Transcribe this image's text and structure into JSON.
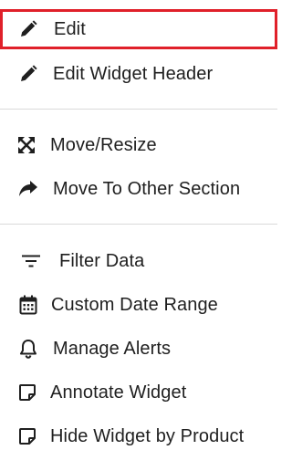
{
  "menu": {
    "items": [
      {
        "label": "Edit",
        "icon": "pencil-icon",
        "selected": true
      },
      {
        "label": "Edit Widget Header",
        "icon": "pencil-icon"
      },
      {
        "label": "Move/Resize",
        "icon": "expand-arrows-icon"
      },
      {
        "label": "Move To Other Section",
        "icon": "share-arrow-icon"
      },
      {
        "label": "Filter Data",
        "icon": "filter-icon"
      },
      {
        "label": "Custom Date Range",
        "icon": "calendar-icon"
      },
      {
        "label": "Manage Alerts",
        "icon": "bell-icon"
      },
      {
        "label": "Annotate Widget",
        "icon": "note-icon"
      },
      {
        "label": "Hide Widget by Product",
        "icon": "note-icon"
      }
    ]
  },
  "colors": {
    "selection_border": "#e0202a",
    "text": "#1f1f1f",
    "divider": "#d9d9d9"
  }
}
